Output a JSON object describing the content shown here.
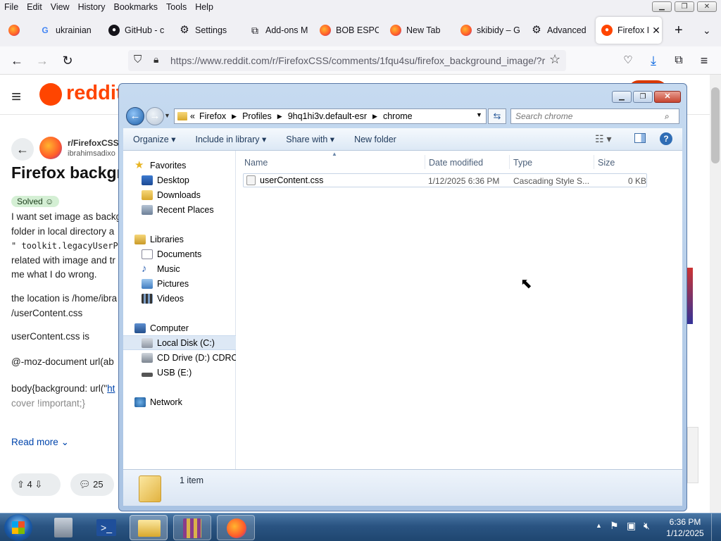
{
  "firefox": {
    "menus": [
      "File",
      "Edit",
      "View",
      "History",
      "Bookmarks",
      "Tools",
      "Help"
    ],
    "tabs": [
      {
        "label": "ukrainian",
        "icon": "google-icon"
      },
      {
        "label": "GitHub - c",
        "icon": "github-icon"
      },
      {
        "label": "Settings",
        "icon": "gear-icon"
      },
      {
        "label": "Add-ons M",
        "icon": "puzzle-icon"
      },
      {
        "label": "BOB ESPO",
        "icon": "firefox-icon"
      },
      {
        "label": "New Tab",
        "icon": "firefox-icon"
      },
      {
        "label": "skibidy – G",
        "icon": "firefox-icon"
      },
      {
        "label": "Advanced",
        "icon": "gear-icon"
      },
      {
        "label": "Firefox I",
        "icon": "reddit-icon",
        "active": true
      }
    ],
    "url": "https://www.reddit.com/r/FirefoxCSS/comments/1fqu4su/firefox_background_image/?r"
  },
  "reddit": {
    "logo": "reddit",
    "subreddit": "r/FirefoxCSS",
    "user": "ibrahimsadixo",
    "title": "Firefox backgr",
    "flair": "Solved",
    "body": [
      "I want set image as backg",
      "folder in local directory a",
      "\" toolkit.legacyUserPro",
      "related with image and tr",
      "me what I do wrong."
    ],
    "location1": "the location is /home/ibra",
    "location2": "/userContent.css",
    "css_is": "userContent.css is",
    "moz_doc": "@-moz-document url(ab",
    "body_css_prefix": "body{background: url(\"",
    "body_css_link": "ht",
    "cover": "cover !important;}",
    "read_more": "Read more",
    "upvotes": "4",
    "comments": "25"
  },
  "explorer": {
    "breadcrumb": [
      "Firefox",
      "Profiles",
      "9hq1hi3v.default-esr",
      "chrome"
    ],
    "search_placeholder": "Search chrome",
    "commands": {
      "organize": "Organize",
      "include": "Include in library",
      "share": "Share with",
      "new_folder": "New folder"
    },
    "nav": {
      "favorites": "Favorites",
      "desktop": "Desktop",
      "downloads": "Downloads",
      "recent": "Recent Places",
      "libraries": "Libraries",
      "documents": "Documents",
      "music": "Music",
      "pictures": "Pictures",
      "videos": "Videos",
      "computer": "Computer",
      "local_disk": "Local Disk (C:)",
      "cd_drive": "CD Drive (D:) CDROM",
      "usb": "USB (E:)",
      "network": "Network"
    },
    "columns": {
      "name": "Name",
      "date": "Date modified",
      "type": "Type",
      "size": "Size"
    },
    "files": [
      {
        "name": "userContent.css",
        "date": "1/12/2025 6:36 PM",
        "type": "Cascading Style S...",
        "size": "0 KB"
      }
    ],
    "status": "1 item"
  },
  "taskbar": {
    "time": "6:36 PM",
    "date": "1/12/2025"
  }
}
